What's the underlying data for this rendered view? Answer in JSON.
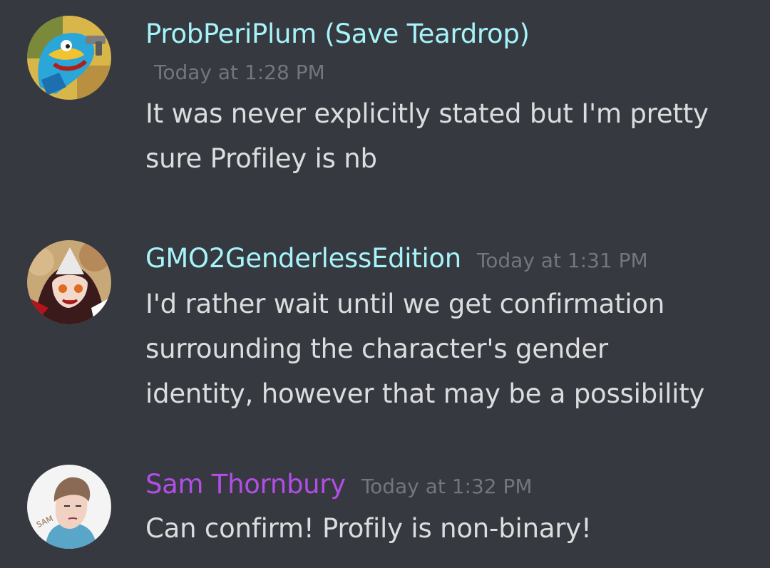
{
  "colors": {
    "background": "#36393f",
    "username_cyan": "#a6f4fa",
    "username_purple": "#b24ee7",
    "timestamp": "#72767d",
    "message_text": "#dcddde"
  },
  "messages": [
    {
      "username": "ProbPeriPlum (Save Teardrop)",
      "timestamp": "Today at 1:28 PM",
      "lines": [
        "It was never explicitly stated but I'm pretty",
        "sure Profiley is nb"
      ],
      "avatar_icon": "cartoon-character-with-gun-avatar"
    },
    {
      "username": "GMO2GenderlessEdition",
      "timestamp": "Today at 1:31 PM",
      "lines": [
        "I'd rather wait until we get confirmation",
        "surrounding the character's gender",
        "identity, however that may be a possibility"
      ],
      "avatar_icon": "anime-character-avatar"
    },
    {
      "username": "Sam Thornbury",
      "timestamp": "Today at 1:32 PM",
      "lines": [
        "Can confirm! Profily is non-binary!"
      ],
      "avatar_icon": "sam-drawing-avatar",
      "avatar_text": "SAM"
    }
  ]
}
